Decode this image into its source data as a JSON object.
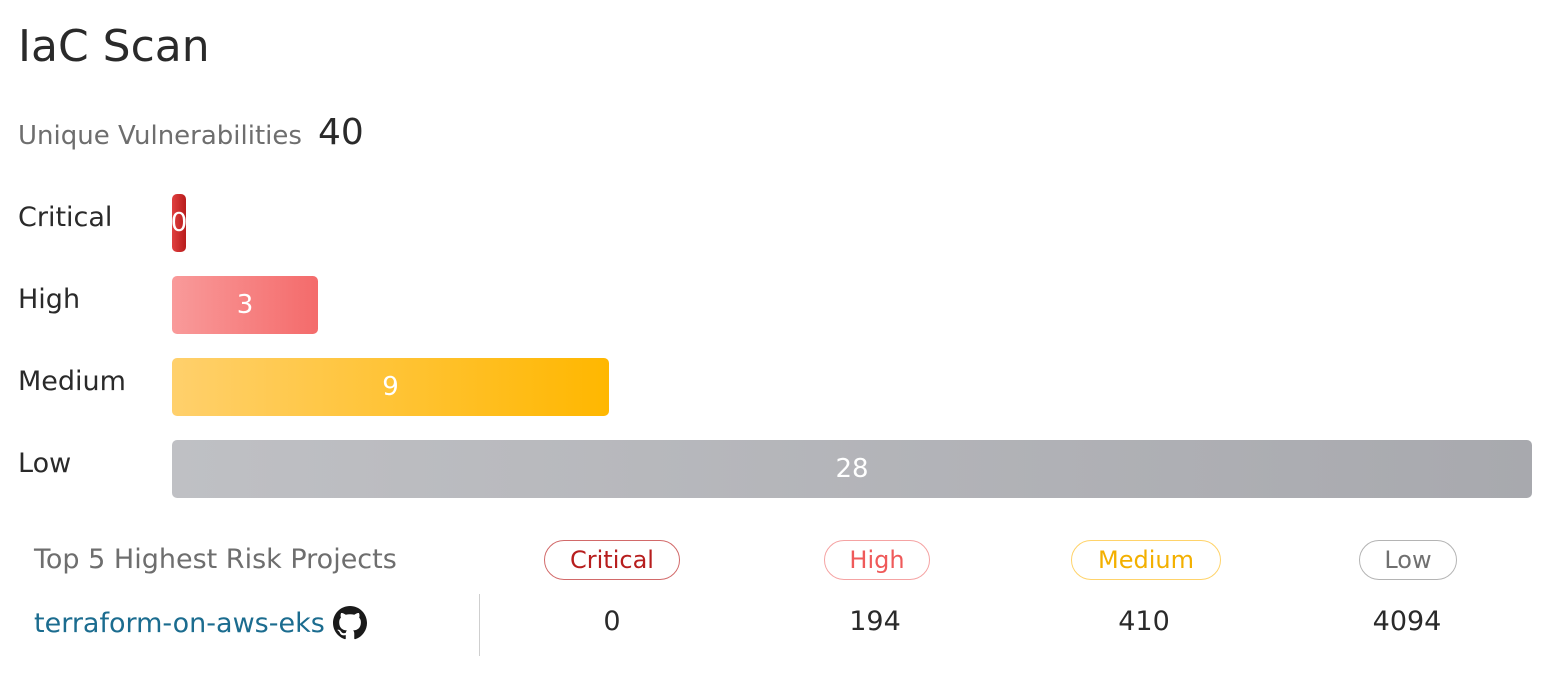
{
  "title": "IaC Scan",
  "unique_vulnerabilities": {
    "label": "Unique Vulnerabilities",
    "value": "40"
  },
  "severity_bars": [
    {
      "label": "Critical",
      "value": 0,
      "color": "#c62828"
    },
    {
      "label": "High",
      "value": 3,
      "color": "#f46b6b"
    },
    {
      "label": "Medium",
      "value": 9,
      "color": "#ffb700"
    },
    {
      "label": "Low",
      "value": 28,
      "color": "#a8a9ae"
    }
  ],
  "table": {
    "header": {
      "projects": "Top 5 Highest Risk Projects",
      "critical": "Critical",
      "high": "High",
      "medium": "Medium",
      "low": "Low"
    },
    "rows": [
      {
        "project": "terraform-on-aws-eks",
        "icon": "github-icon",
        "critical": "0",
        "high": "194",
        "medium": "410",
        "low": "4094"
      }
    ]
  }
}
